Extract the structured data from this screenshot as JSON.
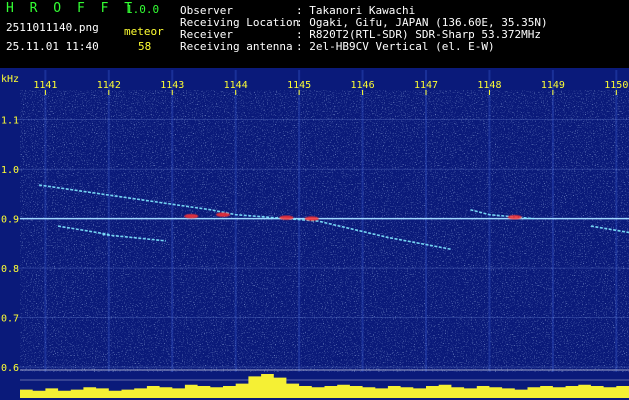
{
  "app": {
    "name": "H R O F F T",
    "version": "1.0.0",
    "filename": "2511011140.png",
    "datetime": "25.11.01 11:40",
    "meteor_label": "meteor",
    "meteor_count": "58"
  },
  "info": {
    "rows": [
      {
        "label": "Observer",
        "value": ": Takanori Kawachi"
      },
      {
        "label": "Receiving Location",
        "value": ": Ogaki, Gifu, JAPAN (136.60E, 35.35N)"
      },
      {
        "label": "Receiver",
        "value": ": R820T2(RTL-SDR) SDR-Sharp 53.372MHz"
      },
      {
        "label": "Receiving antenna",
        "value": ": 2el-HB9CV Vertical (el. E-W)"
      }
    ]
  },
  "colors": {
    "background": "#000000",
    "spectrogram_bg": "#0a1a7a",
    "accent_yellow": "#ffff33",
    "grid_line": "#8fb0ff",
    "echo": "#7fe8ff",
    "echo_hot": "#ff3030"
  },
  "chart_data": {
    "type": "heatmap",
    "ylabel": "kHz",
    "x_ticks": [
      "1141",
      "1142",
      "1143",
      "1144",
      "1145",
      "1146",
      "1147",
      "1148",
      "1149",
      "1150"
    ],
    "y_ticks": [
      "1.1",
      "1.0",
      "0.9",
      "0.8",
      "0.7",
      "0.6"
    ],
    "y_values": [
      1.1,
      1.0,
      0.9,
      0.8,
      0.7,
      0.6
    ],
    "x_range": [
      1140.6,
      1150.2
    ],
    "y_range": [
      0.59,
      1.16
    ],
    "carrier_khz": 0.9,
    "echoes": [
      {
        "x": [
          1140.9,
          1143.6,
          1144.0,
          1145.3,
          1146.4,
          1147.4
        ],
        "y": [
          0.968,
          0.918,
          0.908,
          0.895,
          0.862,
          0.838
        ]
      },
      {
        "x": [
          1141.9,
          1142.9
        ],
        "y": [
          0.868,
          0.855
        ]
      },
      {
        "x": [
          1141.2,
          1142.0
        ],
        "y": [
          0.885,
          0.868
        ]
      },
      {
        "x": [
          1147.7,
          1148.0,
          1148.7
        ],
        "y": [
          0.918,
          0.908,
          0.9
        ]
      },
      {
        "x": [
          1149.6,
          1150.2
        ],
        "y": [
          0.885,
          0.872
        ]
      }
    ],
    "hot_spots": [
      {
        "x": 1143.3,
        "y": 0.905
      },
      {
        "x": 1143.8,
        "y": 0.908
      },
      {
        "x": 1144.8,
        "y": 0.902
      },
      {
        "x": 1145.2,
        "y": 0.9
      },
      {
        "x": 1148.4,
        "y": 0.903
      }
    ],
    "activity_profile": [
      0.35,
      0.3,
      0.4,
      0.3,
      0.35,
      0.45,
      0.4,
      0.3,
      0.35,
      0.4,
      0.5,
      0.45,
      0.4,
      0.55,
      0.5,
      0.45,
      0.5,
      0.6,
      0.9,
      1.0,
      0.85,
      0.6,
      0.5,
      0.45,
      0.5,
      0.55,
      0.5,
      0.45,
      0.4,
      0.5,
      0.45,
      0.4,
      0.5,
      0.55,
      0.45,
      0.4,
      0.5,
      0.45,
      0.4,
      0.35,
      0.45,
      0.5,
      0.45,
      0.5,
      0.55,
      0.5,
      0.45,
      0.5
    ]
  }
}
